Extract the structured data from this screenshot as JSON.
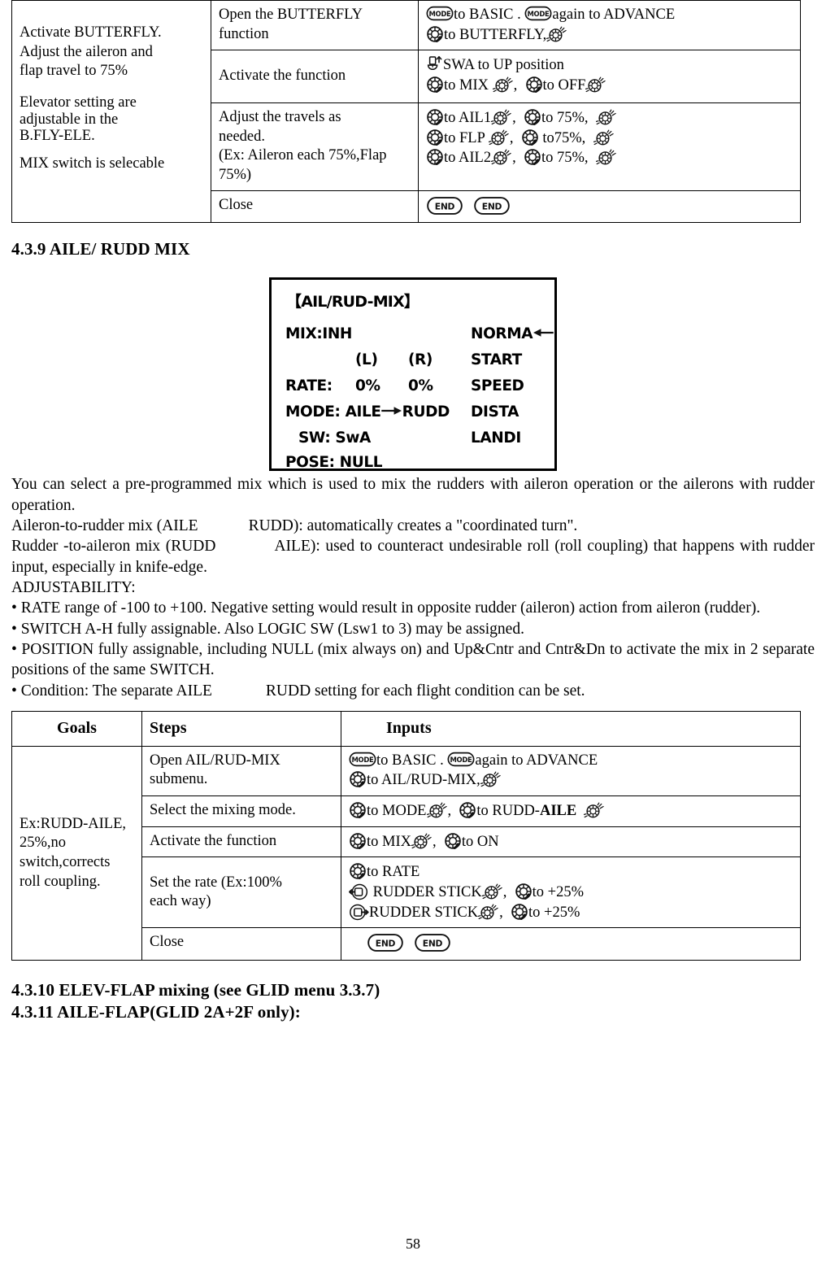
{
  "page": {
    "number": "58"
  },
  "butterfly_table": {
    "goal": "Activate BUTTERFLY.\nAdjust the aileron and\nflap travel to 75%",
    "goal2": "Elevator setting are\nadjustable in the\nB.FLY-ELE.",
    "goal3": "MIX switch is selecable",
    "rows": [
      {
        "step": "Open the BUTTERFLY\nfunction",
        "input_line1_a": "to BASIC .",
        "input_line1_b": "again to ADVANCE",
        "input_line2": "to BUTTERFLY,"
      },
      {
        "step": "Activate the function",
        "input_line1": "SWA to UP position",
        "input_line2_a": "to MIX",
        "input_line2_b": ",",
        "input_line2_c": "to OFF"
      },
      {
        "step": "Adjust the travels as\nneeded.\n(Ex: Aileron each 75%,Flap\n75%)",
        "input_line1_a": "to AIL1",
        "input_line1_b": ",",
        "input_line1_c": "to 75%,",
        "input_line2_a": "to FLP",
        "input_line2_b": ",",
        "input_line2_c": "to75%,",
        "input_line3_a": "to AIL2",
        "input_line3_b": ",",
        "input_line3_c": "to 75%,"
      },
      {
        "step": "Close",
        "end_label": "END"
      }
    ]
  },
  "section": {
    "heading": "4.3.9 AILE/ RUDD MIX"
  },
  "lcd": {
    "title": "【AIL/RUD-MIX】",
    "mix_label": "MIX:INH",
    "col_l": "(L)",
    "col_r": "(R)",
    "rate_label": "RATE:",
    "rate_l": "0%",
    "rate_r": "0%",
    "mode_label": "MODE: AILE",
    "mode_value": "RUDD",
    "sw_label": "SW: SwA",
    "pose_label": "POSE: NULL",
    "right_items": [
      "NORMA",
      "START",
      "SPEED",
      "DISTA",
      "LANDI"
    ]
  },
  "description": {
    "p1": "You can select a pre-programmed mix which is used to mix the rudders with aileron operation or the ailerons with rudder operation.",
    "p2_a": "Aileron-to-rudder mix (AILE",
    "p2_b": "RUDD): automatically creates a \"coordinated turn\".",
    "p3_a": "Rudder -to-aileron mix (RUDD",
    "p3_b": "AILE): used to counteract undesirable roll (roll coupling) that happens with rudder input, especially in knife-edge.",
    "p4": "ADJUSTABILITY:",
    "p5": "• RATE range of -100 to +100. Negative setting would result in opposite rudder (aileron) action from aileron (rudder).",
    "p6": "• SWITCH A-H fully assignable. Also LOGIC SW (Lsw1 to 3) may be assigned.",
    "p7": "• POSITION fully assignable, including NULL (mix always on) and Up&Cntr and Cntr&Dn to activate the mix in 2 separate positions of the same SWITCH.",
    "p8_a": "• Condition: The separate AILE",
    "p8_b": "RUDD setting for each flight condition can be set."
  },
  "mix_table": {
    "headers": [
      "Goals",
      "Steps",
      "Inputs"
    ],
    "goal": "Ex:RUDD-AILE,\n25%,no\nswitch,corrects\nroll coupling.",
    "rows": [
      {
        "step": "Open AIL/RUD-MIX\nsubmenu.",
        "input_line1_a": "to BASIC .",
        "input_line1_b": "again to ADVANCE",
        "input_line2": "to AIL/RUD-MIX,"
      },
      {
        "step": "Select the mixing mode.",
        "input_a": "to MODE",
        "input_b": ",",
        "input_c": "to RUDD-",
        "input_bold": "AILE"
      },
      {
        "step": "Activate the function",
        "input_a": "to MIX",
        "input_b": ",",
        "input_c": "to ON"
      },
      {
        "step": "Set the rate (Ex:100%\neach way)",
        "input_line1": "to RATE",
        "input_line2_a": "RUDDER STICK",
        "input_line2_b": ",",
        "input_line2_c": "to +25%",
        "input_line3_a": "RUDDER STICK",
        "input_line3_b": ",",
        "input_line3_c": "to +25%"
      },
      {
        "step": "Close",
        "end_label": "END"
      }
    ]
  },
  "footer_sections": {
    "s1_num": "4.3.10",
    "s1_text": " ELEV-FLAP mixing (see GLID menu 3.3.7)",
    "s2": "4.3.11 AILE-FLAP(GLID 2A+2F only):"
  }
}
